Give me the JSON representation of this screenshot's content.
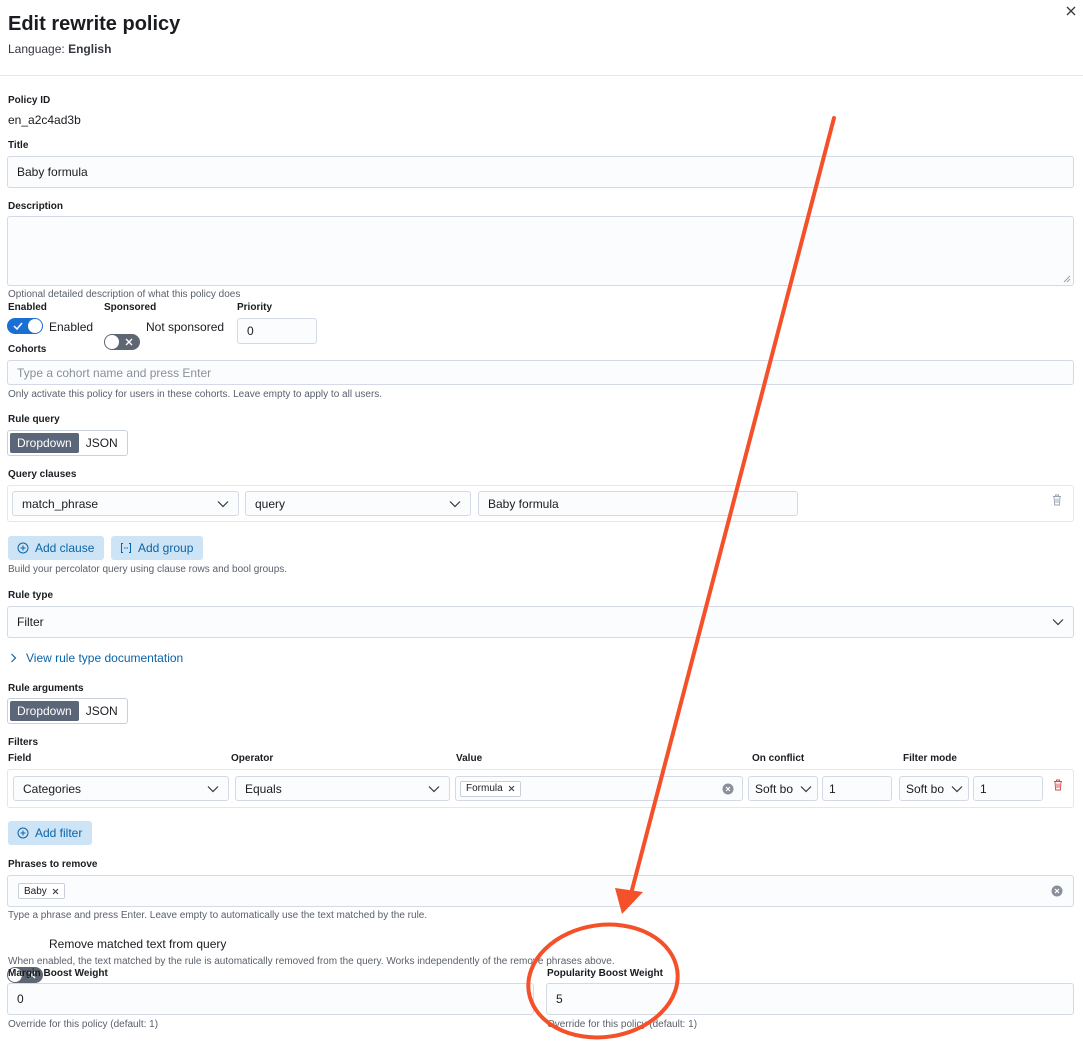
{
  "header": {
    "title": "Edit rewrite policy",
    "language_label": "Language:",
    "language_value": "English"
  },
  "policy_id": {
    "label": "Policy ID",
    "value": "en_a2c4ad3b"
  },
  "title_field": {
    "label": "Title",
    "value": "Baby formula"
  },
  "description": {
    "label": "Description",
    "value": "",
    "help": "Optional detailed description of what this policy does"
  },
  "enabled": {
    "label": "Enabled",
    "state_text": "Enabled"
  },
  "sponsored": {
    "label": "Sponsored",
    "state_text": "Not sponsored"
  },
  "priority": {
    "label": "Priority",
    "value": "0"
  },
  "cohorts": {
    "label": "Cohorts",
    "placeholder": "Type a cohort name and press Enter",
    "help": "Only activate this policy for users in these cohorts. Leave empty to apply to all users."
  },
  "rule_query": {
    "label": "Rule query",
    "modes": [
      "Dropdown",
      "JSON"
    ]
  },
  "query_clauses": {
    "label": "Query clauses",
    "clause": {
      "type": "match_phrase",
      "field": "query",
      "value": "Baby formula"
    },
    "add_clause": "Add clause",
    "add_group": "Add group",
    "help": "Build your percolator query using clause rows and bool groups."
  },
  "rule_type": {
    "label": "Rule type",
    "value": "Filter",
    "doc_link": "View rule type documentation"
  },
  "rule_arguments": {
    "label": "Rule arguments",
    "modes": [
      "Dropdown",
      "JSON"
    ]
  },
  "filters": {
    "label": "Filters",
    "columns": [
      "Field",
      "Operator",
      "Value",
      "On conflict",
      "Filter mode"
    ],
    "row": {
      "field": "Categories",
      "operator": "Equals",
      "value_chip": "Formula",
      "on_conflict": "Soft bo",
      "on_conflict_num": "1",
      "filter_mode": "Soft bo",
      "filter_mode_num": "1"
    },
    "add_filter": "Add filter"
  },
  "phrases": {
    "label": "Phrases to remove",
    "chip": "Baby",
    "help": "Type a phrase and press Enter. Leave empty to automatically use the text matched by the rule."
  },
  "remove_matched": {
    "label": "Remove matched text from query",
    "help": "When enabled, the text matched by the rule is automatically removed from the query. Works independently of the remove phrases above."
  },
  "margin_boost": {
    "label": "Margin Boost Weight",
    "value": "0",
    "help": "Override for this policy (default: 1)"
  },
  "popularity_boost": {
    "label": "Popularity Boost Weight",
    "value": "5",
    "help": "Override for this policy (default: 1)"
  },
  "annotation": {
    "color": "#f4502a"
  }
}
